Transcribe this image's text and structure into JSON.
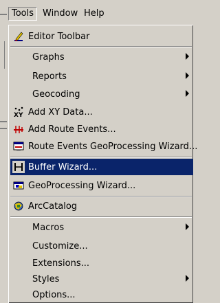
{
  "menubar": {
    "items": [
      {
        "label": "Tools",
        "active": true
      },
      {
        "label": "Window",
        "active": false
      },
      {
        "label": "Help",
        "active": false
      }
    ]
  },
  "menu": {
    "items": [
      {
        "label": "Editor Toolbar",
        "icon": "pencil-icon",
        "submenu": false
      },
      {
        "label": "Graphs",
        "icon": null,
        "submenu": true
      },
      {
        "label": "Reports",
        "icon": null,
        "submenu": true
      },
      {
        "label": "Geocoding",
        "icon": null,
        "submenu": true
      },
      {
        "label": "Add XY Data...",
        "icon": "xy-data-icon",
        "submenu": false
      },
      {
        "label": "Add Route Events...",
        "icon": "route-events-icon",
        "submenu": false
      },
      {
        "label": "Route Events GeoProcessing Wizard...",
        "icon": "route-geoprocessing-icon",
        "submenu": false
      },
      {
        "label": "Buffer Wizard...",
        "icon": "buffer-icon",
        "submenu": false,
        "highlighted": true
      },
      {
        "label": "GeoProcessing Wizard...",
        "icon": "geoprocessing-icon",
        "submenu": false
      },
      {
        "label": "ArcCatalog",
        "icon": "arccatalog-icon",
        "submenu": false
      },
      {
        "label": "Macros",
        "icon": null,
        "submenu": true
      },
      {
        "label": "Customize...",
        "icon": null,
        "submenu": false
      },
      {
        "label": "Extensions...",
        "icon": null,
        "submenu": false
      },
      {
        "label": "Styles",
        "icon": null,
        "submenu": true
      },
      {
        "label": "Options...",
        "icon": null,
        "submenu": false
      }
    ]
  },
  "colors": {
    "face": "#d4d0c8",
    "highlight": "#0a246a",
    "highlight_text": "#ffffff"
  }
}
